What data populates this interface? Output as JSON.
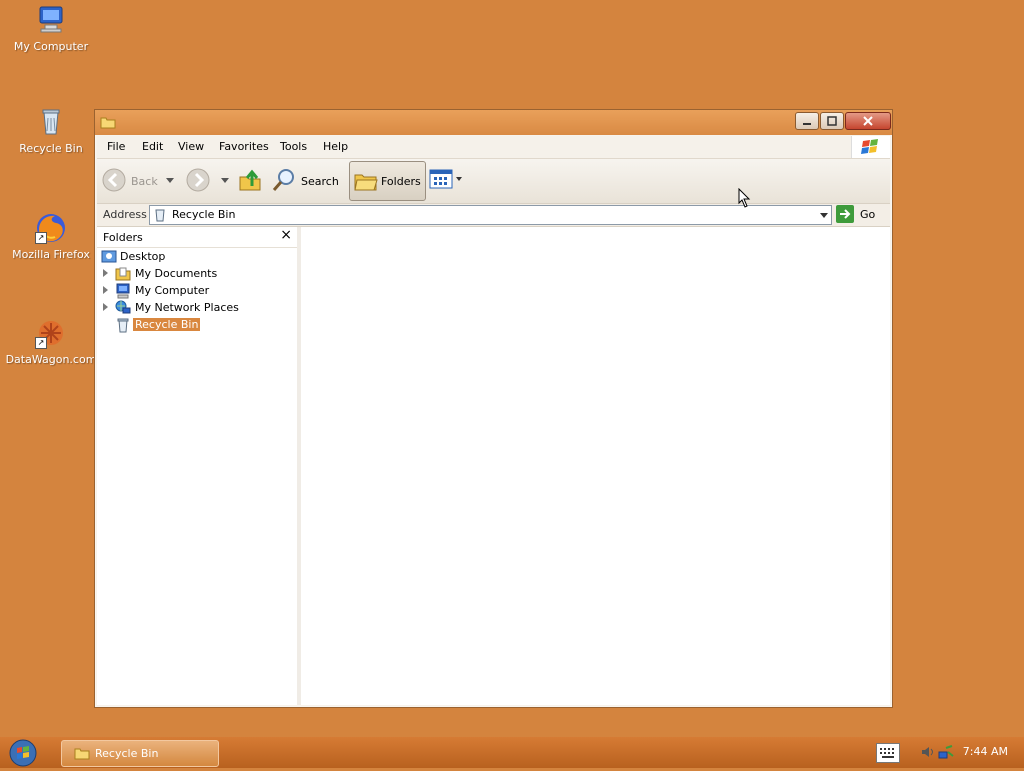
{
  "desktop": {
    "icons": [
      {
        "label": "My Computer"
      },
      {
        "label": "Recycle Bin"
      },
      {
        "label": "Mozilla Firefox"
      },
      {
        "label": "DataWagon.com"
      }
    ]
  },
  "window": {
    "title": "",
    "menu": [
      "File",
      "Edit",
      "View",
      "Favorites",
      "Tools",
      "Help"
    ],
    "toolbar": {
      "back_label": "Back",
      "search_label": "Search",
      "folders_label": "Folders"
    },
    "address": {
      "label": "Address",
      "value": "Recycle Bin",
      "go_label": "Go"
    },
    "folders_pane": {
      "title": "Folders",
      "close_glyph": "×",
      "items": [
        {
          "label": "Desktop"
        },
        {
          "label": "My Documents"
        },
        {
          "label": "My Computer"
        },
        {
          "label": "My Network Places"
        },
        {
          "label": "Recycle Bin",
          "selected": true
        }
      ]
    }
  },
  "taskbar": {
    "task_label": "Recycle Bin",
    "clock": "7:44 AM"
  },
  "colors": {
    "desktop_bg": "#d4843e",
    "selection": "#d9873f"
  }
}
